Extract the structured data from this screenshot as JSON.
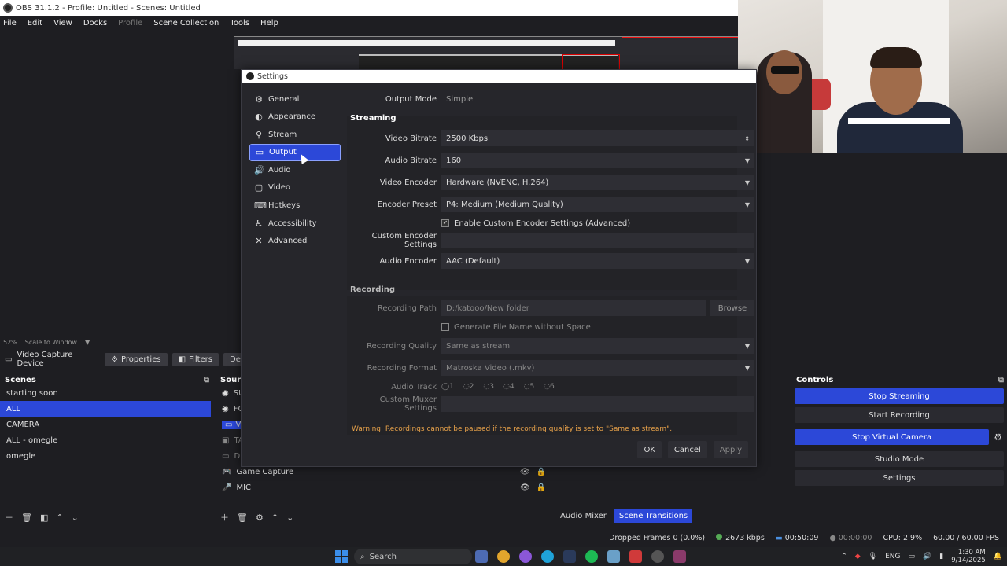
{
  "window": {
    "title": "OBS 31.1.2 - Profile: Untitled - Scenes: Untitled"
  },
  "menu": [
    "File",
    "Edit",
    "View",
    "Docks",
    "Profile",
    "Scene Collection",
    "Tools",
    "Help"
  ],
  "zoom": {
    "percent": "52%",
    "mode": "Scale to Window"
  },
  "source_toolbar": {
    "source_name": "Video Capture Device",
    "properties": "Properties",
    "filters": "Filters",
    "deactivate": "Dea"
  },
  "scenes": {
    "header": "Scenes",
    "items": [
      "starting soon",
      "ALL",
      "CAMERA",
      "ALL - omegle",
      "omegle"
    ],
    "selected_index": 1
  },
  "sources": {
    "header": "Sources",
    "items": [
      "SU",
      "FO",
      "Vid",
      "TA",
      "Dis",
      "Game Capture",
      "MIC"
    ]
  },
  "controls": {
    "header": "Controls",
    "stop_streaming": "Stop Streaming",
    "start_recording": "Start Recording",
    "stop_virtual_camera": "Stop Virtual Camera",
    "studio_mode": "Studio Mode",
    "settings": "Settings"
  },
  "mixer_tabs": {
    "audio_mixer": "Audio Mixer",
    "scene_transitions": "Scene Transitions"
  },
  "status": {
    "dropped_frames": "Dropped Frames 0 (0.0%)",
    "bitrate": "2673 kbps",
    "stream_time": "00:50:09",
    "rec_time": "00:00:00",
    "cpu": "CPU: 2.9%",
    "fps": "60.00 / 60.00 FPS"
  },
  "taskbar": {
    "search": "Search",
    "lang": "ENG",
    "time": "1:30 AM",
    "date": "9/14/2025"
  },
  "settings": {
    "title": "Settings",
    "nav": [
      "General",
      "Appearance",
      "Stream",
      "Output",
      "Audio",
      "Video",
      "Hotkeys",
      "Accessibility",
      "Advanced"
    ],
    "nav_selected": 3,
    "output_mode_label": "Output Mode",
    "output_mode_value": "Simple",
    "streaming_header": "Streaming",
    "video_bitrate_label": "Video Bitrate",
    "video_bitrate_value": "2500 Kbps",
    "audio_bitrate_label": "Audio Bitrate",
    "audio_bitrate_value": "160",
    "video_encoder_label": "Video Encoder",
    "video_encoder_value": "Hardware (NVENC, H.264)",
    "encoder_preset_label": "Encoder Preset",
    "encoder_preset_value": "P4: Medium (Medium Quality)",
    "enable_custom_label": "Enable Custom Encoder Settings (Advanced)",
    "custom_encoder_label": "Custom Encoder Settings",
    "audio_encoder_label": "Audio Encoder",
    "audio_encoder_value": "AAC (Default)",
    "recording_header": "Recording",
    "recording_path_label": "Recording Path",
    "recording_path_value": "D:/katooo/New folder",
    "browse": "Browse",
    "gen_filename_label": "Generate File Name without Space",
    "recording_quality_label": "Recording Quality",
    "recording_quality_value": "Same as stream",
    "recording_format_label": "Recording Format",
    "recording_format_value": "Matroska Video (.mkv)",
    "audio_track_label": "Audio Track",
    "audio_tracks": [
      "1",
      "2",
      "3",
      "4",
      "5",
      "6"
    ],
    "custom_muxer_label": "Custom Muxer Settings",
    "warning": "Warning: Recordings cannot be paused if the recording quality is set to \"Same as stream\".",
    "ok": "OK",
    "cancel": "Cancel",
    "apply": "Apply"
  }
}
